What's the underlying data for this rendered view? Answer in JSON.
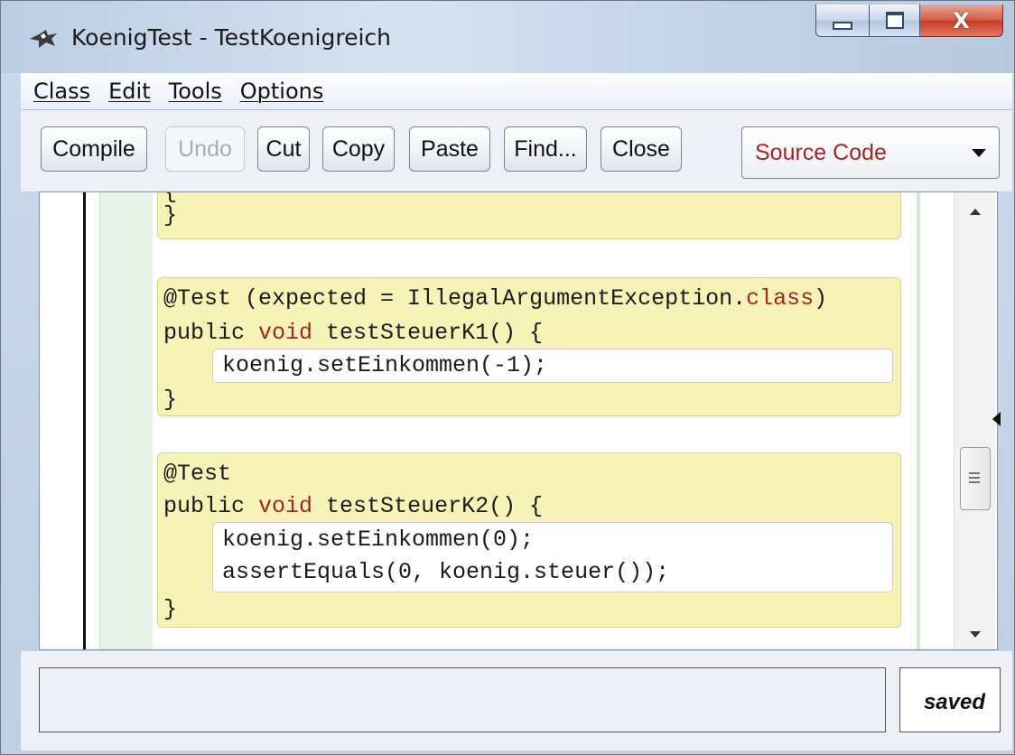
{
  "window": {
    "title": "KoenigTest - TestKoenigreich",
    "controls": {
      "minimize": "minimize",
      "maximize": "maximize",
      "close": "X"
    }
  },
  "menu": [
    "Class",
    "Edit",
    "Tools",
    "Options"
  ],
  "toolbar": {
    "buttons": [
      {
        "label": "Compile",
        "enabled": true
      },
      {
        "label": "Undo",
        "enabled": false
      },
      {
        "label": "Cut",
        "enabled": true
      },
      {
        "label": "Copy",
        "enabled": true
      },
      {
        "label": "Paste",
        "enabled": true
      },
      {
        "label": "Find...",
        "enabled": true
      },
      {
        "label": "Close",
        "enabled": true
      }
    ],
    "view_select": {
      "value": "Source Code",
      "icon": "chevron-down-icon"
    }
  },
  "editor": {
    "code": {
      "block1_top_partial": "{",
      "block1_close": "}",
      "test1_annotation": "@Test (expected = IllegalArgumentException.",
      "test1_annotation_kw": "class",
      "test1_annotation_end": ")",
      "test1_sig_prefix": "public ",
      "test1_sig_kw": "void",
      "test1_sig_suffix": " testSteuerK1() {",
      "test1_body": "koenig.setEinkommen(-1);",
      "test1_close": "}",
      "test2_annotation": "@Test",
      "test2_sig_prefix": "public ",
      "test2_sig_kw": "void",
      "test2_sig_suffix": " testSteuerK2() {",
      "test2_body_line1": "koenig.setEinkommen(0);",
      "test2_body_line2": "assertEquals(0, koenig.steuer());",
      "test2_close": "}"
    },
    "colors": {
      "keyword": "#a0262a",
      "method_bg": "#f7f3b7",
      "body_bg": "#ffffff",
      "gutter_green": "#e6f4e7"
    }
  },
  "status": {
    "message": "",
    "saved_label": "saved"
  }
}
